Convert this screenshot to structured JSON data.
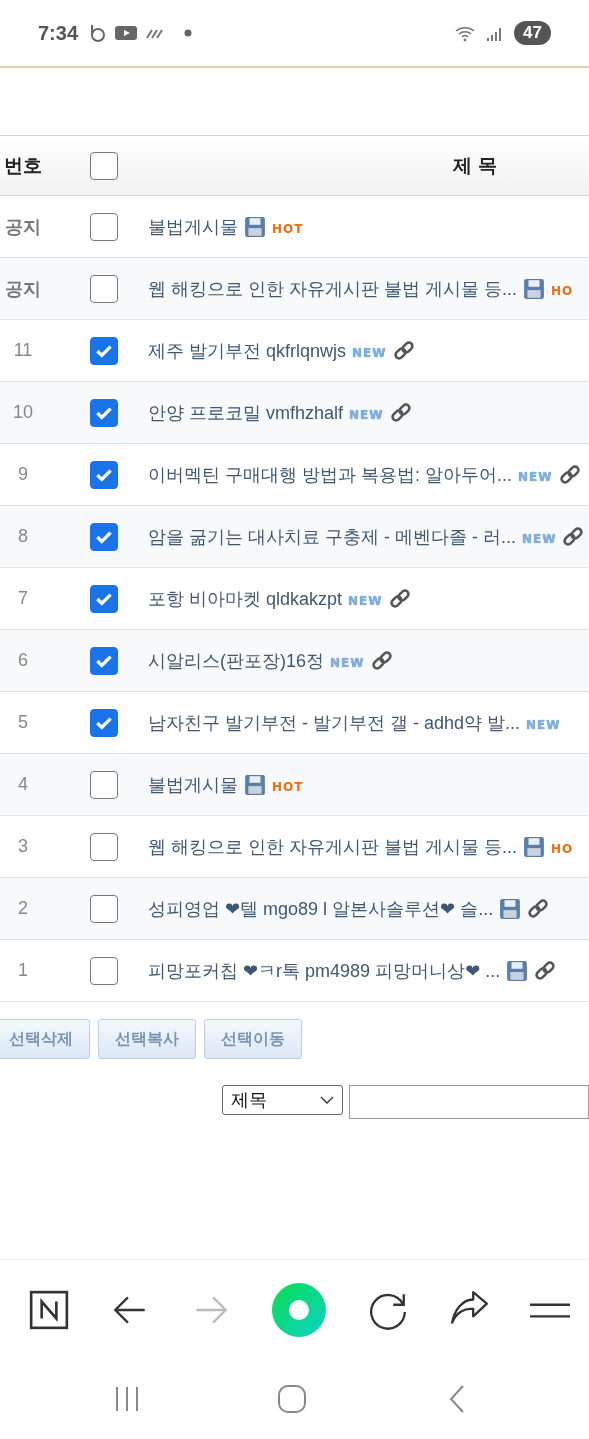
{
  "status_bar": {
    "time": "7:34",
    "battery": "47"
  },
  "table": {
    "columns": [
      "번호",
      "제 목"
    ],
    "select_all": {
      "checked": false
    },
    "rows": [
      {
        "number": "공지",
        "notice": true,
        "checked": false,
        "title": "불법게시물",
        "marks": [
          {
            "kind": "file"
          },
          {
            "kind": "hot",
            "text": "HOT"
          }
        ]
      },
      {
        "number": "공지",
        "notice": true,
        "checked": false,
        "title": "웹 해킹으로 인한 자유게시판 불법 게시물 등...",
        "marks": [
          {
            "kind": "file"
          },
          {
            "kind": "hot",
            "text": "HO"
          }
        ]
      },
      {
        "number": "11",
        "notice": false,
        "checked": true,
        "title": "제주 발기부전 qkfrlqnwjs",
        "marks": [
          {
            "kind": "new",
            "text": "NEW"
          },
          {
            "kind": "link"
          }
        ]
      },
      {
        "number": "10",
        "notice": false,
        "checked": true,
        "title": "안양 프로코밀 vmfhzhalf",
        "marks": [
          {
            "kind": "new",
            "text": "NEW"
          },
          {
            "kind": "link"
          }
        ]
      },
      {
        "number": "9",
        "notice": false,
        "checked": true,
        "title": "이버멕틴 구매대행 방법과 복용법: 알아두어...",
        "marks": [
          {
            "kind": "new",
            "text": "NEW"
          },
          {
            "kind": "link"
          }
        ]
      },
      {
        "number": "8",
        "notice": false,
        "checked": true,
        "title": "암을 굶기는 대사치료 구충제 - 메벤다졸 - 러...",
        "marks": [
          {
            "kind": "new",
            "text": "NEW"
          },
          {
            "kind": "link"
          }
        ]
      },
      {
        "number": "7",
        "notice": false,
        "checked": true,
        "title": "포항 비아마켓 qldkakzpt",
        "marks": [
          {
            "kind": "new",
            "text": "NEW"
          },
          {
            "kind": "link"
          }
        ]
      },
      {
        "number": "6",
        "notice": false,
        "checked": true,
        "title": "시알리스(판포장)16정",
        "marks": [
          {
            "kind": "new",
            "text": "NEW"
          },
          {
            "kind": "link"
          }
        ]
      },
      {
        "number": "5",
        "notice": false,
        "checked": true,
        "title": "남자친구 발기부전 - 발기부전 갤 - adhd약 발...",
        "marks": [
          {
            "kind": "new",
            "text": "NEW"
          }
        ]
      },
      {
        "number": "4",
        "notice": false,
        "checked": false,
        "title": "불법게시물",
        "marks": [
          {
            "kind": "file"
          },
          {
            "kind": "hot",
            "text": "HOT"
          }
        ]
      },
      {
        "number": "3",
        "notice": false,
        "checked": false,
        "title": "웹 해킹으로 인한 자유게시판 불법 게시물 등...",
        "marks": [
          {
            "kind": "file"
          },
          {
            "kind": "hot",
            "text": "HO"
          }
        ]
      },
      {
        "number": "2",
        "notice": false,
        "checked": false,
        "title": "성피영업 ❤텔 mgo89 l 알본사솔루션❤ 슬...",
        "marks": [
          {
            "kind": "file"
          },
          {
            "kind": "link"
          }
        ]
      },
      {
        "number": "1",
        "notice": false,
        "checked": false,
        "title": "피망포커칩 ❤ㅋr톡 pm4989 피망머니상❤ ...",
        "marks": [
          {
            "kind": "file"
          },
          {
            "kind": "link"
          }
        ]
      }
    ]
  },
  "buttons": [
    "선택삭제",
    "선택복사",
    "선택이동"
  ],
  "search": {
    "field": "제목"
  }
}
